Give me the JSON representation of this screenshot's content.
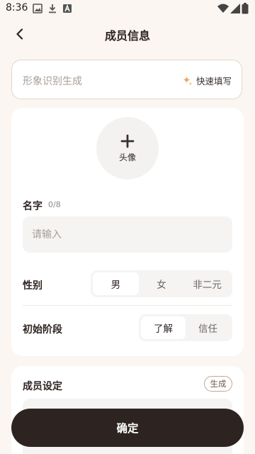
{
  "status_bar": {
    "time": "8:36",
    "left_icons": [
      "image-icon",
      "download-icon",
      "app-notification-icon"
    ],
    "right_icons": [
      "wifi-icon",
      "signal-icon",
      "battery-icon"
    ]
  },
  "nav": {
    "title": "成员信息",
    "back_icon": "chevron-left-icon"
  },
  "recognize": {
    "placeholder": "形象识别生成",
    "quick_fill_label": "快速填写",
    "quick_fill_icon": "sparkle-icon"
  },
  "avatar": {
    "label": "头像",
    "icon": "plus-icon"
  },
  "name": {
    "label": "名字",
    "count": "0/8",
    "placeholder": "请输入",
    "value": ""
  },
  "gender": {
    "label": "性别",
    "options": [
      "男",
      "女",
      "非二元"
    ],
    "selected": "男"
  },
  "stage": {
    "label": "初始阶段",
    "options": [
      "了解",
      "信任"
    ],
    "selected": "了解"
  },
  "settings": {
    "label": "成员设定",
    "generate_label": "生成"
  },
  "confirm_label": "确定",
  "colors": {
    "background": "#FBF6F1",
    "primary_button": "#2D2421",
    "sparkle_accent": "#F0A45C",
    "border_accent": "#E5D6C6"
  }
}
